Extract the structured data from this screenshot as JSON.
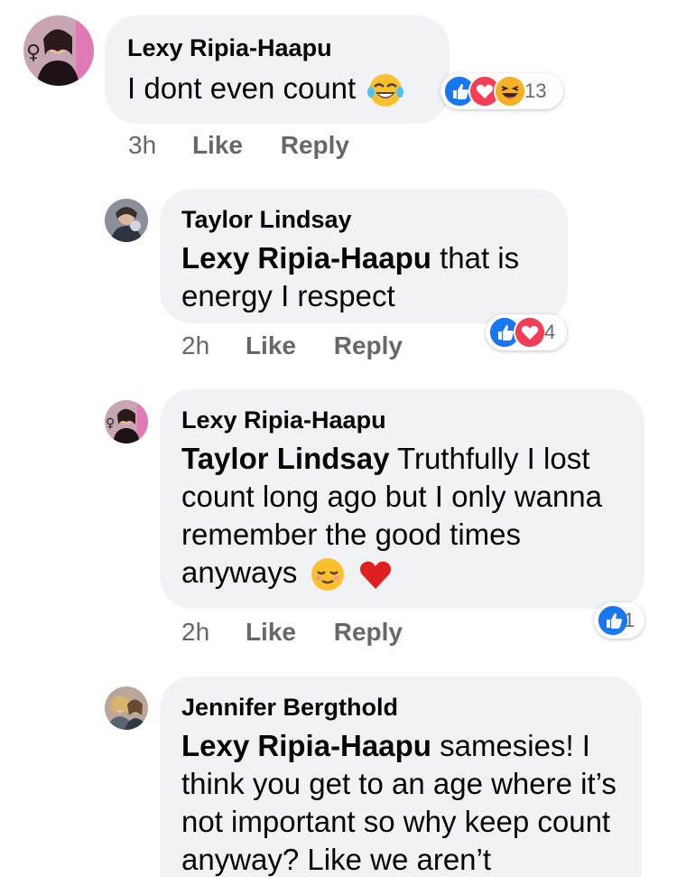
{
  "comments": [
    {
      "author": "Lexy Ripia-Haapu",
      "text": "I dont even count",
      "time": "3h",
      "like_label": "Like",
      "reply_label": "Reply",
      "reaction_icons": [
        "like-icon",
        "love-icon",
        "haha-icon"
      ],
      "reaction_count": "13",
      "inline_emoji": [
        "laughing-tears-emoji"
      ]
    },
    {
      "author": "Taylor Lindsay",
      "mention": "Lexy Ripia-Haapu",
      "text": " that is energy I respect",
      "time": "2h",
      "like_label": "Like",
      "reply_label": "Reply",
      "reaction_icons": [
        "like-icon",
        "love-icon"
      ],
      "reaction_count": "4"
    },
    {
      "author": "Lexy Ripia-Haapu",
      "mention": "Taylor Lindsay",
      "text": " Truthfully I lost count long ago but I only wanna remember the good times anyways",
      "time": "2h",
      "like_label": "Like",
      "reply_label": "Reply",
      "reaction_icons": [
        "like-icon"
      ],
      "reaction_count": "1",
      "inline_emoji": [
        "relieved-face-emoji",
        "red-heart-emoji"
      ]
    },
    {
      "author": "Jennifer Bergthold",
      "mention": "Lexy Ripia-Haapu",
      "text": " samesies! I think you get to an age where it’s not important so why keep count anyway? Like we aren’t"
    }
  ],
  "colors": {
    "bubble": "#f0f2f5",
    "like_blue": "#1877f2",
    "love_red": "#f33e58",
    "haha_yellow": "#f7b125",
    "meta_gray": "#65676b"
  }
}
